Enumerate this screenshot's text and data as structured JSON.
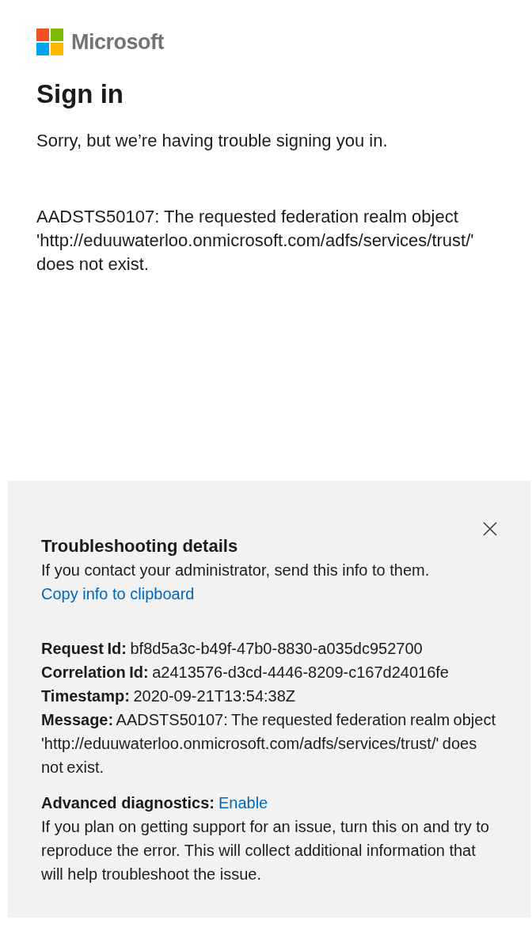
{
  "logo": {
    "wordmark": "Microsoft"
  },
  "title": "Sign in",
  "subtitle": "Sorry, but we’re having trouble signing you in.",
  "error_message": "AADSTS50107: The requested federation realm object 'http://eduuwaterloo.onmicrosoft.com/adfs/services/trust/' does not exist.",
  "troubleshooting": {
    "title": "Troubleshooting details",
    "description": "If you contact your administrator, send this info to them.",
    "copy_link": "Copy info to clipboard",
    "details": [
      "**Request Id:** bf8d5a3c-b49f-47b0-8830-a035dc952700",
      "**Correlation Id:** a2413576-d3cd-4446-8209-c167d24016fe",
      "**Timestamp:** 2020-09-21T13:54:38Z",
      "**Message:** AADSTS50107: The requested federation realm object 'http://eduuwaterloo.onmicrosoft.com/adfs/services/trust/' does not exist."
    ],
    "advanced": {
      "label": "Advanced diagnostics:",
      "link": "Enable",
      "description": "If you plan on getting support for an issue, turn this on and try to reproduce the error. This will collect additional information that will help troubleshoot the issue."
    }
  }
}
